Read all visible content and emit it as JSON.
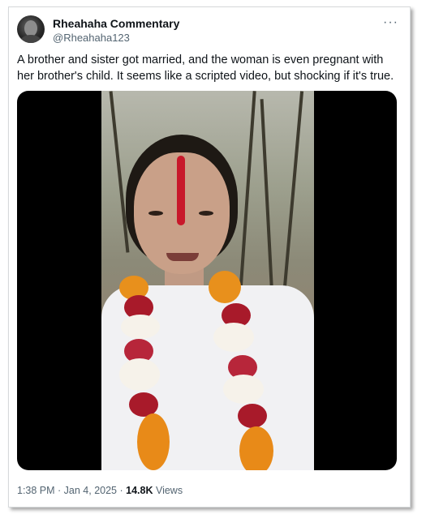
{
  "tweet": {
    "author_name": "Rheahaha Commentary",
    "author_handle": "@Rheahaha123",
    "more_icon": "···",
    "text": "A brother and sister got married, and the woman is even pregnant with her brother's child. It seems like a scripted video, but shocking if it's true.",
    "time": "1:38 PM",
    "separator": " · ",
    "date": "Jan 4, 2025",
    "views_count": "14.8K",
    "views_label": " Views"
  }
}
